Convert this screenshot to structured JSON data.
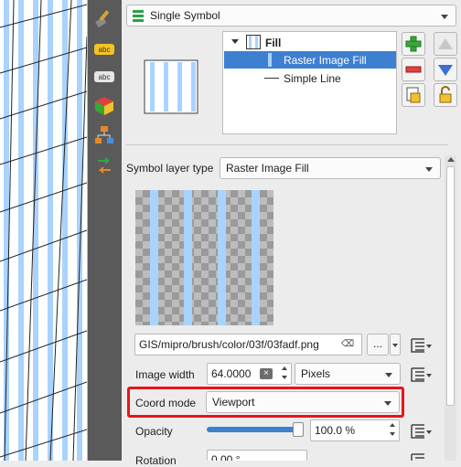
{
  "renderer": {
    "label": "Single Symbol"
  },
  "symbol_tree": {
    "root": "Fill",
    "layers": [
      "Raster Image Fill",
      "Simple Line"
    ]
  },
  "layer_type": {
    "label": "Symbol layer type",
    "value": "Raster Image Fill"
  },
  "image_path": {
    "value": "GIS/mipro/brush/color/03f/03fadf.png",
    "browse_label": "..."
  },
  "image_width": {
    "label": "Image width",
    "value": "64.0000",
    "unit": "Pixels"
  },
  "coord_mode": {
    "label": "Coord mode",
    "value": "Viewport"
  },
  "opacity": {
    "label": "Opacity",
    "value": "100.0 %",
    "level": 1.0
  },
  "rotation": {
    "label": "Rotation",
    "value": "0.00 °"
  },
  "colors": {
    "accent": "#3d7fd0",
    "highlight_border": "#e8141c",
    "stripe": "#a9d3ff"
  }
}
